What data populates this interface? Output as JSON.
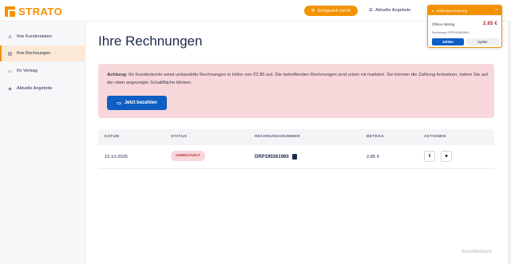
{
  "header": {
    "logo_text": "STRATO",
    "ki_button": "Erfolgreich mit KI",
    "offers_link": "Aktuelle Angebote"
  },
  "sidebar": {
    "items": [
      {
        "label": "Ihre Kundendaten",
        "icon": "user-icon"
      },
      {
        "label": "Ihre Rechnungen",
        "icon": "document-icon"
      },
      {
        "label": "Ihr Vertrag",
        "icon": "contract-icon"
      },
      {
        "label": "Aktuelle Angebote",
        "icon": "tag-icon"
      }
    ]
  },
  "main": {
    "title": "Ihre Rechnungen",
    "alert": {
      "strong": "Achtung:",
      "text": " Ihr Kundenkonto weist unbezahlte Rechnungen in Höhe von €2.85 auf. Die betreffenden Rechnungen sind unten rot markiert. Sie können die Zahlung fortsetzen, indem Sie auf die oben angezeigte Schaltfläche klicken.",
      "button": "Jetzt bezahlen"
    },
    "table": {
      "headers": [
        "DATUM",
        "STATUS",
        "RECHNUNGSNUMMER",
        "BETRAG",
        "AKTIONEN"
      ],
      "rows": [
        {
          "date": "15.10.2025",
          "status": "UNBEZAHLT",
          "number": "DRP190261960",
          "amount": "2,85 €"
        }
      ]
    }
  },
  "popup": {
    "title": "Zahlungserinnerung",
    "label": "Offener Betrag",
    "amount": "2.85 €",
    "ref": "Rechnung: DRP190261960",
    "pay": "Zahlen",
    "later": "Später"
  },
  "watermark": "ScanMalware",
  "colors": {
    "accent": "#f39200",
    "primary": "#0f5ec4",
    "alert_bg": "#f8d7da",
    "danger": "#b0343c"
  }
}
